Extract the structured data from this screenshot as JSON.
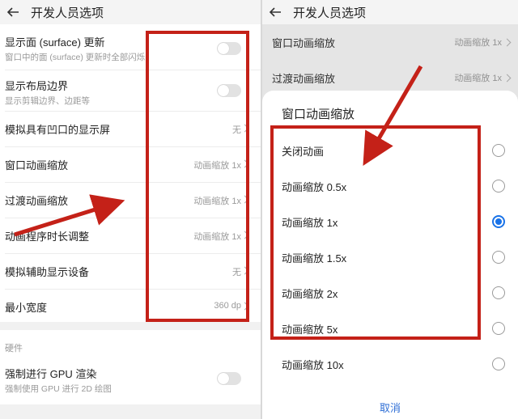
{
  "colors": {
    "annotation_red": "#c42118",
    "accent_blue": "#1a73e8"
  },
  "left": {
    "title": "开发人员选项",
    "rows": [
      {
        "label": "显示面 (surface) 更新",
        "sub": "窗口中的面 (surface) 更新时全部闪烁",
        "control": "toggle-off"
      },
      {
        "label": "显示布局边界",
        "sub": "显示剪辑边界、边距等",
        "control": "toggle-off"
      },
      {
        "label": "模拟具有凹口的显示屏",
        "value": "无"
      },
      {
        "label": "窗口动画缩放",
        "value": "动画缩放 1x"
      },
      {
        "label": "过渡动画缩放",
        "value": "动画缩放 1x"
      },
      {
        "label": "动画程序时长调整",
        "value": "动画缩放 1x"
      },
      {
        "label": "模拟辅助显示设备",
        "value": "无"
      },
      {
        "label": "最小宽度",
        "value": "360 dp"
      }
    ],
    "section_header": "硬件",
    "gpu": {
      "label": "强制进行 GPU 渲染",
      "sub": "强制使用 GPU 进行 2D 绘图",
      "control": "toggle-off"
    }
  },
  "right": {
    "title": "开发人员选项",
    "bg_rows": [
      {
        "label": "窗口动画缩放",
        "value": "动画缩放 1x"
      },
      {
        "label": "过渡动画缩放",
        "value": "动画缩放 1x"
      }
    ],
    "dialog": {
      "title": "窗口动画缩放",
      "options": [
        "关闭动画",
        "动画缩放 0.5x",
        "动画缩放 1x",
        "动画缩放 1.5x",
        "动画缩放 2x",
        "动画缩放 5x",
        "动画缩放 10x"
      ],
      "selected": "动画缩放 1x",
      "cancel": "取消"
    }
  }
}
